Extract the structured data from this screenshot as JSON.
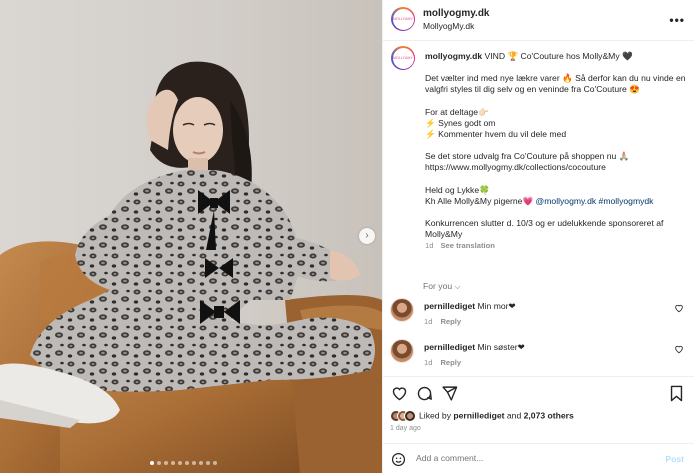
{
  "header": {
    "username": "mollyogmy.dk",
    "subtitle": "MollyogMy.dk",
    "avatar_text": "MOLLY&MY",
    "more": "•••"
  },
  "caption": {
    "username": "mollyogmy.dk",
    "line1": "VIND 🏆 Co'Couture hos Molly&My 🖤",
    "para1": "Det vælter ind med nye lækre varer 🔥 Så derfor kan du nu vinde en valgfri styles til dig selv og en veninde fra Co'Couture 😍",
    "para2_title": "For at deltage👉🏻",
    "para2_item1": "⚡ Synes godt om",
    "para2_item2": "⚡ Kommenter hvem du vil dele med",
    "para3": "Se det store udvalg fra Co'Couture på shoppen nu 🙏🏼",
    "url": "https://www.mollyogmy.dk/collections/cocouture",
    "para4_line1": "Held og Lykke🍀",
    "para4_line2": "Kh Alle Molly&My pigerne💗",
    "mention": "@mollyogmy.dk",
    "hashtag": "#mollyogmydk",
    "para5": "Konkurrencen slutter d. 10/3 og er udelukkende sponsoreret af Molly&My",
    "time": "1d",
    "see_translation": "See translation"
  },
  "for_you": "For you",
  "comments": [
    {
      "username": "pernillediget",
      "text": "Min mor❤",
      "time": "1d",
      "reply": "Reply"
    },
    {
      "username": "pernillediget",
      "text": "Min søster❤",
      "time": "1d",
      "reply": "Reply"
    }
  ],
  "likes": {
    "prefix": "Liked by",
    "user": "pernillediget",
    "and": "and",
    "others": "2,073 others"
  },
  "posted_ago": "1 day ago",
  "add_comment": {
    "placeholder": "Add a comment...",
    "post": "Post"
  },
  "icons": [
    "heart-icon",
    "comment-icon",
    "share-icon",
    "bookmark-icon",
    "emoji-icon",
    "chevron-right-icon"
  ]
}
